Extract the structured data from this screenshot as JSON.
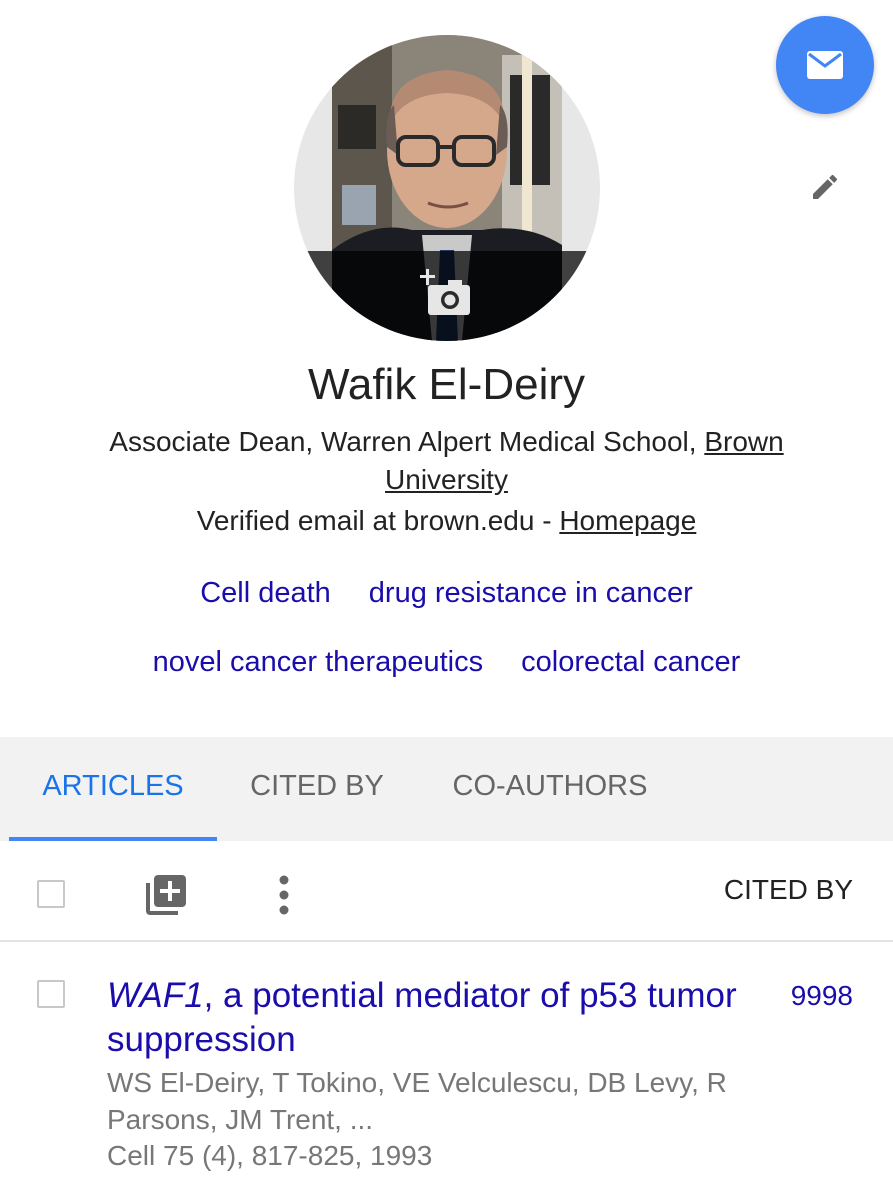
{
  "profile": {
    "name": "Wafik El-Deiry",
    "affiliation_prefix": "Associate Dean, Warren Alpert Medical School, ",
    "affiliation_link": "Brown University",
    "email_text": "Verified email at brown.edu - ",
    "homepage_link": "Homepage"
  },
  "interests": {
    "row1": [
      "Cell death",
      "drug resistance in cancer"
    ],
    "row2": [
      "novel cancer therapeutics",
      "colorectal cancer"
    ]
  },
  "tabs": [
    {
      "label": "ARTICLES",
      "active": true
    },
    {
      "label": "CITED BY",
      "active": false
    },
    {
      "label": "CO-AUTHORS",
      "active": false
    }
  ],
  "toolbar": {
    "cited_by_header": "CITED BY"
  },
  "articles": [
    {
      "title_italic": "WAF1",
      "title_rest": ", a potential mediator of p53 tumor suppression",
      "authors": "WS El-Deiry, T Tokino, VE Velculescu, DB Levy, R Parsons, JM Trent, ...",
      "source": "Cell 75 (4), 817-825, 1993",
      "cited_by": "9998"
    }
  ],
  "colors": {
    "accent": "#4285f4",
    "link": "#1a0dab",
    "tab_active": "#1a73e8"
  },
  "icons": [
    "mail-icon",
    "pencil-icon",
    "add-photo-icon",
    "add-to-library-icon",
    "more-vert-icon"
  ]
}
